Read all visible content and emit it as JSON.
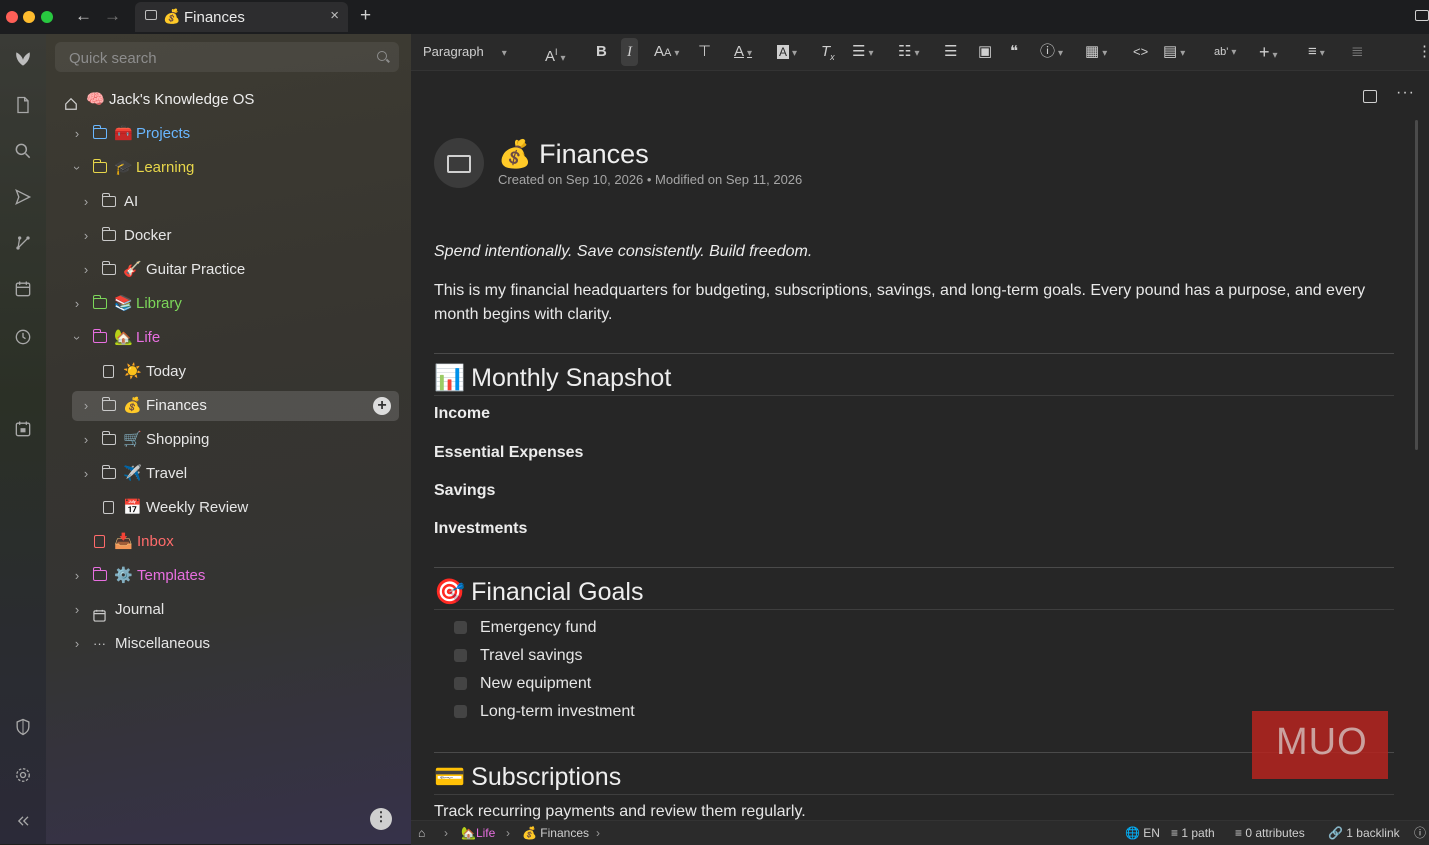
{
  "window": {
    "tab_title": "Finances",
    "tab_emoji": "💰",
    "close_glyph": "×",
    "new_tab_glyph": "+",
    "back_glyph": "←",
    "forward_glyph": "→"
  },
  "sidebar": {
    "search_placeholder": "Quick search",
    "root": {
      "label": "Jack's Knowledge OS",
      "emoji": "🧠"
    },
    "items": [
      {
        "label": "Projects",
        "emoji": "🧰",
        "color": "#6ab7ff",
        "expanded": false
      },
      {
        "label": "Learning",
        "emoji": "🎓",
        "color": "#e7d64a",
        "expanded": true
      },
      {
        "label": "AI",
        "emoji": "",
        "color": "#e6e6e6",
        "expanded": false
      },
      {
        "label": "Docker",
        "emoji": "",
        "color": "#e6e6e6",
        "expanded": false
      },
      {
        "label": "Guitar Practice",
        "emoji": "🎸",
        "color": "#e6e6e6",
        "expanded": false
      },
      {
        "label": "Library",
        "emoji": "📚",
        "color": "#7cd65a",
        "expanded": false
      },
      {
        "label": "Life",
        "emoji": "🏡",
        "color": "#e86fe0",
        "expanded": true
      },
      {
        "label": "Today",
        "emoji": "☀️",
        "color": "#e6e6e6",
        "type": "note"
      },
      {
        "label": "Finances",
        "emoji": "💰",
        "color": "#ececec",
        "selected": true
      },
      {
        "label": "Shopping",
        "emoji": "🛒",
        "color": "#e6e6e6"
      },
      {
        "label": "Travel",
        "emoji": "✈️",
        "color": "#e6e6e6"
      },
      {
        "label": "Weekly Review",
        "emoji": "📅",
        "color": "#e6e6e6",
        "type": "note"
      },
      {
        "label": "Inbox",
        "emoji": "📥",
        "color": "#ff6b6b",
        "type": "note"
      },
      {
        "label": "Templates",
        "emoji": "⚙️",
        "color": "#e86fe0"
      },
      {
        "label": "Journal",
        "emoji": "",
        "color": "#e6e6e6",
        "type": "calendar"
      },
      {
        "label": "Miscellaneous",
        "emoji": "",
        "color": "#e6e6e6",
        "type": "dots"
      }
    ]
  },
  "toolbar": {
    "paragraph_label": "Paragraph",
    "icons": [
      "font-size-icon",
      "bold-icon",
      "italic-icon",
      "text-case-icon",
      "format-painter-icon",
      "text-color-icon",
      "highlight-icon",
      "clear-format-icon",
      "bullet-list-icon",
      "numbered-list-icon",
      "todo-list-icon",
      "image-icon",
      "quote-icon",
      "callout-icon",
      "table-icon",
      "code-icon",
      "include-note-icon",
      "spellcheck-icon",
      "insert-icon",
      "align-icon",
      "outdent-icon",
      "more-icon"
    ]
  },
  "document": {
    "emoji": "💰",
    "title": "Finances",
    "meta": "Created on Sep 10, 2026 • Modified on Sep 11, 2026",
    "tagline": "Spend intentionally. Save consistently. Build freedom.",
    "intro": "This is my financial headquarters for budgeting, subscriptions, savings, and long-term goals. Every pound has a purpose, and every month begins with clarity.",
    "sections": {
      "snapshot": {
        "emoji": "📊",
        "heading": "Monthly Snapshot",
        "rows": [
          "Income",
          "Essential Expenses",
          "Savings",
          "Investments"
        ]
      },
      "goals": {
        "emoji": "🎯",
        "heading": "Financial Goals",
        "items": [
          "Emergency fund",
          "Travel savings",
          "New equipment",
          "Long-term investment"
        ]
      },
      "subscriptions": {
        "emoji": "💳",
        "heading": "Subscriptions",
        "text": "Track recurring payments and review them regularly."
      }
    }
  },
  "watermark": "MUO",
  "statusbar": {
    "crumb_life": "Life",
    "crumb_life_emoji": "🏡",
    "crumb_finances": "Finances",
    "crumb_finances_emoji": "💰",
    "language": "EN",
    "paths": "1 path",
    "attributes": "0 attributes",
    "backlinks": "1 backlink"
  },
  "colors": {
    "accent_red": "#fe5f57",
    "accent_yellow": "#febc2e",
    "accent_green": "#28c840"
  }
}
